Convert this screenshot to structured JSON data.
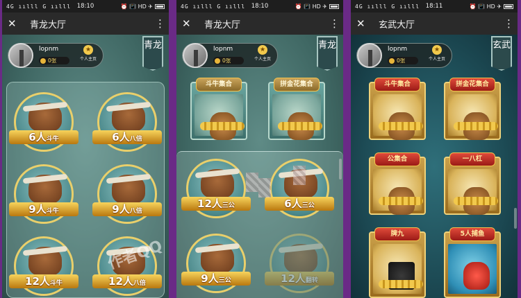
{
  "screens": [
    {
      "status": {
        "left": "4G ıılll G ıılll",
        "time": "18:10",
        "right": "⏰ 📳 HD ✈︎",
        "battery_icon": "battery-icon"
      },
      "title": "青龙大厅",
      "close_icon": "close-icon",
      "more_icon": "more-icon",
      "user": {
        "name": "lopnm",
        "coins": "0张",
        "homepage_label": "个人主页"
      },
      "banner": "青龙",
      "rooms": [
        {
          "count": "6人",
          "mode": "斗牛"
        },
        {
          "count": "6人",
          "mode": "八倍"
        },
        {
          "count": "9人",
          "mode": "斗牛"
        },
        {
          "count": "9人",
          "mode": "八倍"
        },
        {
          "count": "12人",
          "mode": "斗牛"
        },
        {
          "count": "12人",
          "mode": "八倍"
        }
      ],
      "watermark": "作者QQ"
    },
    {
      "status": {
        "left": "4G ıılll G ıılll",
        "time": "18:10",
        "right": "⏰ 📳 HD ✈︎"
      },
      "title": "青龙大厅",
      "user": {
        "name": "lopnm",
        "coins": "0张",
        "homepage_label": "个人主页"
      },
      "banner": "青龙",
      "categories": [
        "斗牛集合",
        "拼金花集合"
      ],
      "rooms": [
        {
          "count": "12人",
          "mode": "三公"
        },
        {
          "count": "6人",
          "mode": "三公"
        },
        {
          "count": "9人",
          "mode": "三公"
        },
        {
          "count": "12人",
          "mode": "翻转"
        }
      ]
    },
    {
      "status": {
        "left": "4G ıılll G ıılll",
        "time": "18:11",
        "right": "⏰ 📳 HD ✈︎"
      },
      "title": "玄武大厅",
      "user": {
        "name": "lopnm",
        "coins": "0张",
        "homepage_label": "个人主页"
      },
      "banner": "玄武",
      "categories": [
        "斗牛集合",
        "拼金花集合",
        "公集合",
        "一八杠",
        "牌九",
        "5人捕鱼"
      ]
    }
  ]
}
